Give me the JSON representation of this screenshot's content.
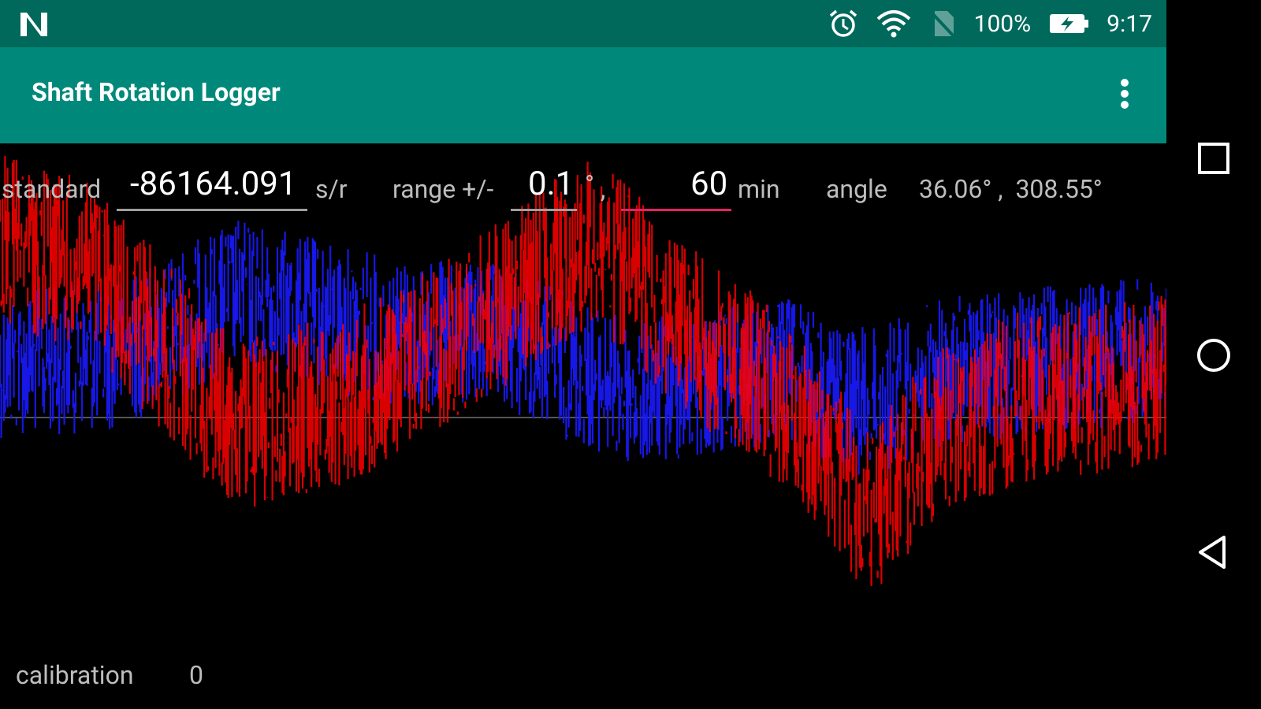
{
  "status_bar": {
    "battery": "100%",
    "time": "9:17",
    "icons": [
      "n-logo-icon",
      "alarm-icon",
      "wifi-icon",
      "no-sim-icon",
      "battery-charging-icon"
    ]
  },
  "app_bar": {
    "title": "Shaft Rotation Logger",
    "menu_icon": "overflow-menu-icon"
  },
  "controls": {
    "standard_label": "standard",
    "standard_value": "-86164.091",
    "standard_unit": "s/r",
    "range_label": "range +/-",
    "range_value": "0.1",
    "range_unit": "°",
    "separator": ",",
    "duration_value": "60",
    "duration_unit": "min",
    "angle_label": "angle",
    "angle_values": "36.06° ,  308.55°"
  },
  "calibration": {
    "label": "calibration",
    "value": "0"
  },
  "nav_bar": {
    "icons": [
      "recents-icon",
      "home-icon",
      "back-icon"
    ]
  },
  "colors": {
    "status_bar": "#00695c",
    "app_bar": "#00897b",
    "series_a": "#ff0000",
    "series_b": "#1a1aff",
    "accent": "#e91e63"
  }
}
